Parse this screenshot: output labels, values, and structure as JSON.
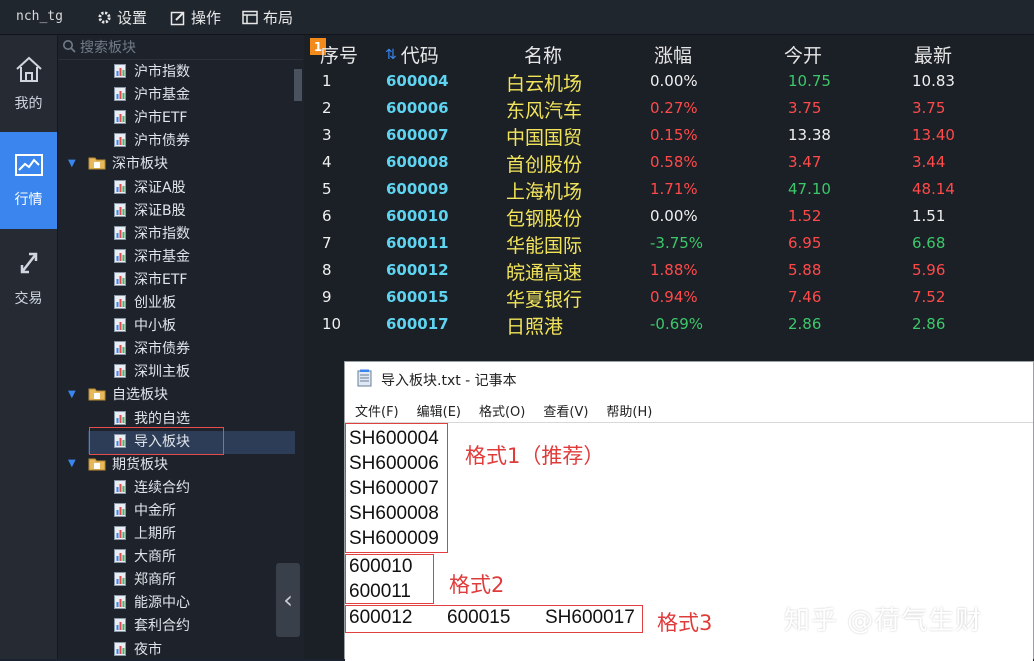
{
  "topbar": {
    "app_title": "nch_tg",
    "menus": [
      {
        "label": "设置",
        "icon": "gear-icon"
      },
      {
        "label": "操作",
        "icon": "edit-icon"
      },
      {
        "label": "布局",
        "icon": "layout-icon"
      }
    ]
  },
  "nav": [
    {
      "label": "我的",
      "icon": "home-icon",
      "active": false
    },
    {
      "label": "行情",
      "icon": "chart-icon",
      "active": true
    },
    {
      "label": "交易",
      "icon": "exchange-icon",
      "active": false
    }
  ],
  "tree": {
    "search_placeholder": "搜索板块",
    "rows": [
      {
        "label": "沪市指数",
        "kind": "file"
      },
      {
        "label": "沪市基金",
        "kind": "file"
      },
      {
        "label": "沪市ETF",
        "kind": "file"
      },
      {
        "label": "沪市债券",
        "kind": "file"
      },
      {
        "label": "深市板块",
        "kind": "folder"
      },
      {
        "label": "深证A股",
        "kind": "file"
      },
      {
        "label": "深证B股",
        "kind": "file"
      },
      {
        "label": "深市指数",
        "kind": "file"
      },
      {
        "label": "深市基金",
        "kind": "file"
      },
      {
        "label": "深市ETF",
        "kind": "file"
      },
      {
        "label": "创业板",
        "kind": "file"
      },
      {
        "label": "中小板",
        "kind": "file"
      },
      {
        "label": "深市债券",
        "kind": "file"
      },
      {
        "label": "深圳主板",
        "kind": "file"
      },
      {
        "label": "自选板块",
        "kind": "folder"
      },
      {
        "label": "我的自选",
        "kind": "file"
      },
      {
        "label": "导入板块",
        "kind": "file",
        "selected": true
      },
      {
        "label": "期货板块",
        "kind": "folder"
      },
      {
        "label": "连续合约",
        "kind": "file"
      },
      {
        "label": "中金所",
        "kind": "file"
      },
      {
        "label": "上期所",
        "kind": "file"
      },
      {
        "label": "大商所",
        "kind": "file"
      },
      {
        "label": "郑商所",
        "kind": "file"
      },
      {
        "label": "能源中心",
        "kind": "file"
      },
      {
        "label": "套利合约",
        "kind": "file"
      },
      {
        "label": "夜市",
        "kind": "file"
      }
    ]
  },
  "grid": {
    "badge": "1",
    "headers": {
      "seq": "序号",
      "code": "代码",
      "name": "名称",
      "change": "涨幅",
      "open": "今开",
      "last": "最新"
    },
    "rows": [
      {
        "seq": "1",
        "code": "600004",
        "name": "白云机场",
        "change": "0.00%",
        "open": "10.75",
        "last": "10.83",
        "change_color": "#f0f0f0",
        "open_color": "#3cc86a",
        "last_color": "#f0f0f0"
      },
      {
        "seq": "2",
        "code": "600006",
        "name": "东风汽车",
        "change": "0.27%",
        "open": "3.75",
        "last": "3.75",
        "change_color": "#ff4a4a",
        "open_color": "#ff4a4a",
        "last_color": "#ff4a4a"
      },
      {
        "seq": "3",
        "code": "600007",
        "name": "中国国贸",
        "change": "0.15%",
        "open": "13.38",
        "last": "13.40",
        "change_color": "#ff4a4a",
        "open_color": "#f0f0f0",
        "last_color": "#ff4a4a"
      },
      {
        "seq": "4",
        "code": "600008",
        "name": "首创股份",
        "change": "0.58%",
        "open": "3.47",
        "last": "3.44",
        "change_color": "#ff4a4a",
        "open_color": "#ff4a4a",
        "last_color": "#ff4a4a"
      },
      {
        "seq": "5",
        "code": "600009",
        "name": "上海机场",
        "change": "1.71%",
        "open": "47.10",
        "last": "48.14",
        "change_color": "#ff4a4a",
        "open_color": "#3cc86a",
        "last_color": "#ff4a4a"
      },
      {
        "seq": "6",
        "code": "600010",
        "name": "包钢股份",
        "change": "0.00%",
        "open": "1.52",
        "last": "1.51",
        "change_color": "#f0f0f0",
        "open_color": "#ff4a4a",
        "last_color": "#f0f0f0"
      },
      {
        "seq": "7",
        "code": "600011",
        "name": "华能国际",
        "change": "-3.75%",
        "open": "6.95",
        "last": "6.68",
        "change_color": "#3cc86a",
        "open_color": "#ff4a4a",
        "last_color": "#3cc86a"
      },
      {
        "seq": "8",
        "code": "600012",
        "name": "皖通高速",
        "change": "1.88%",
        "open": "5.88",
        "last": "5.96",
        "change_color": "#ff4a4a",
        "open_color": "#ff4a4a",
        "last_color": "#ff4a4a"
      },
      {
        "seq": "9",
        "code": "600015",
        "name": "华夏银行",
        "change": "0.94%",
        "open": "7.46",
        "last": "7.52",
        "change_color": "#ff4a4a",
        "open_color": "#ff4a4a",
        "last_color": "#ff4a4a"
      },
      {
        "seq": "10",
        "code": "600017",
        "name": "日照港",
        "change": "-0.69%",
        "open": "2.86",
        "last": "2.86",
        "change_color": "#3cc86a",
        "open_color": "#3cc86a",
        "last_color": "#3cc86a"
      }
    ],
    "code_color": "#5fd4f0",
    "name_color": "#f2e45a"
  },
  "notepad": {
    "title": "导入板块.txt - 记事本",
    "menu": [
      "文件(F)",
      "编辑(E)",
      "格式(O)",
      "查看(V)",
      "帮助(H)"
    ],
    "format1_lines": [
      "SH600004",
      "SH600006",
      "SH600007",
      "SH600008",
      "SH600009"
    ],
    "format2_lines": [
      "600010",
      "600011"
    ],
    "format3_items": [
      "600012",
      "600015",
      "SH600017"
    ],
    "label1": "格式1（推荐）",
    "label2": "格式2",
    "label3": "格式3"
  },
  "watermark": "知乎 @荷气生财"
}
